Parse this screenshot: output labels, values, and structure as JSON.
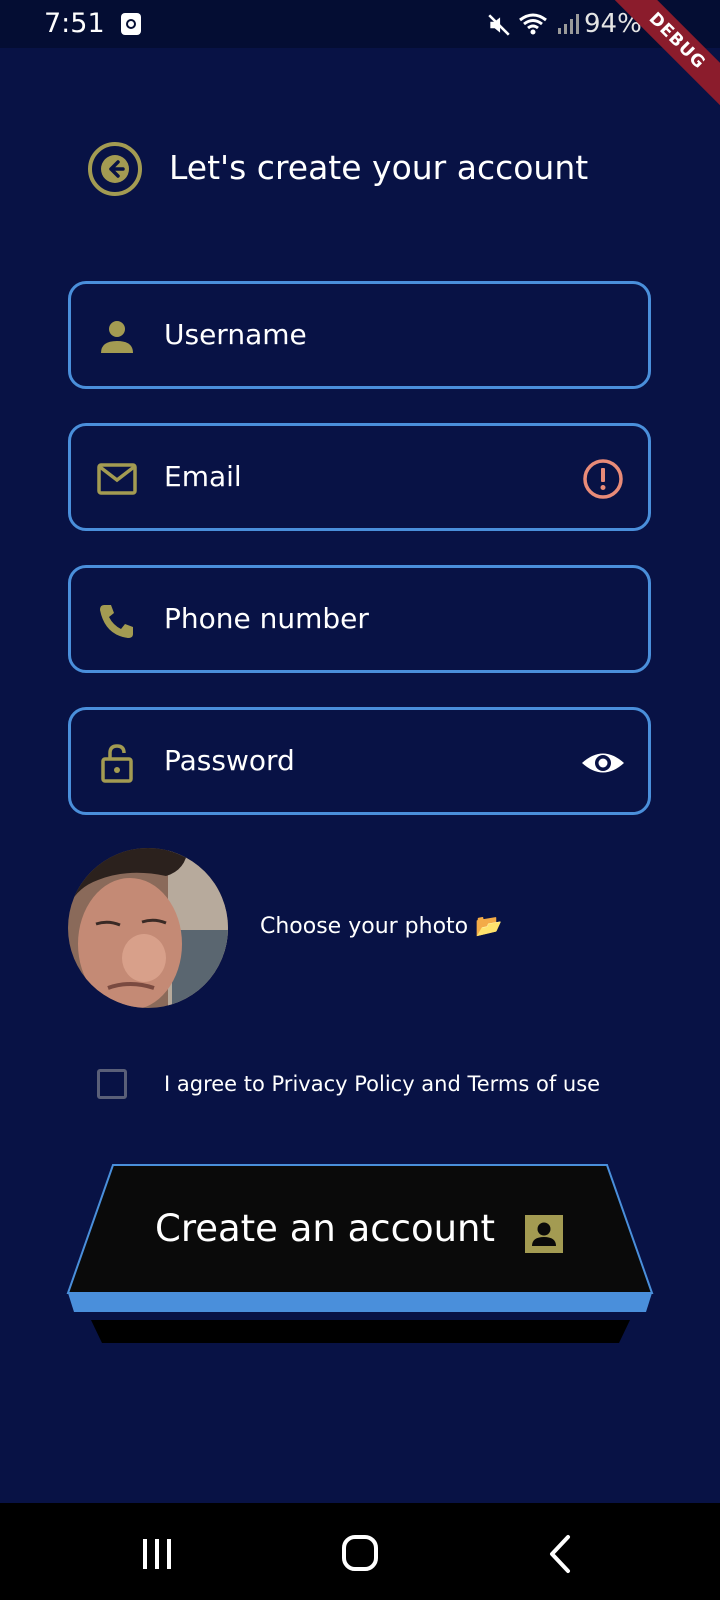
{
  "status_bar": {
    "time": "7:51",
    "battery": "94%",
    "debug_banner": "DEBUG",
    "icons": [
      "app-notification-icon",
      "mute-icon",
      "wifi-icon",
      "signal-icon",
      "battery-charging-icon"
    ]
  },
  "header": {
    "title": "Let's create your account",
    "back_icon": "arrow-left-circle-icon"
  },
  "form": {
    "username": {
      "placeholder": "Username",
      "icon": "person-icon"
    },
    "email": {
      "placeholder": "Email",
      "icon": "mail-icon",
      "trailing_icon": "error-icon"
    },
    "phone": {
      "placeholder": "Phone number",
      "icon": "phone-icon"
    },
    "password": {
      "placeholder": "Password",
      "icon": "lock-open-icon",
      "trailing_icon": "eye-icon"
    }
  },
  "photo": {
    "label": "Choose your photo 📂"
  },
  "agreement": {
    "label": "I agree to Privacy Policy and Terms of use",
    "checked": false
  },
  "submit": {
    "label": "Create an account",
    "icon": "contact-card-icon"
  },
  "colors": {
    "background": "#081245",
    "field_border": "#4a8fdb",
    "icon_olive": "#a39b52",
    "error": "#e98b78",
    "button_fill": "#0a0a0a"
  },
  "nav_bar": {
    "buttons": [
      "recent-apps-icon",
      "home-icon",
      "back-icon"
    ]
  }
}
